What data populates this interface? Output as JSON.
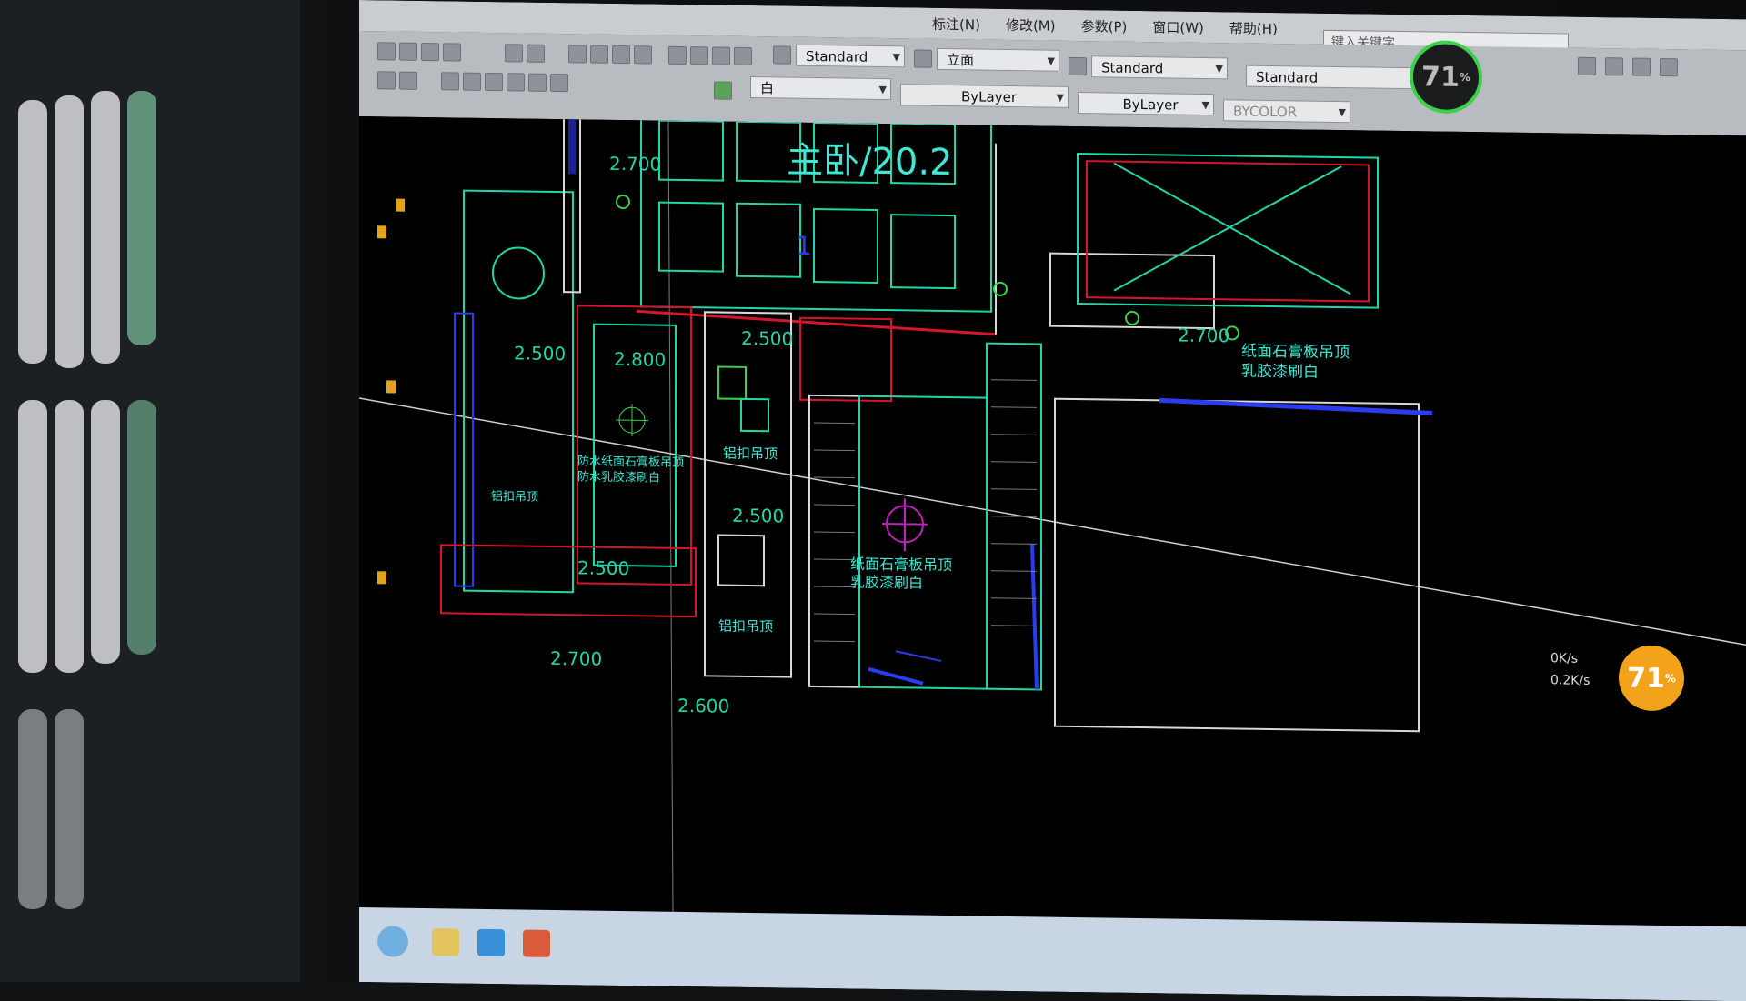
{
  "menu": {
    "items": [
      "标注(N)",
      "修改(M)",
      "参数(P)",
      "窗口(W)",
      "帮助(H)"
    ]
  },
  "search": {
    "placeholder": "键入关键字"
  },
  "toolbar": {
    "text_style": "Standard",
    "dim_style": "立面",
    "table_style": "Standard",
    "multileader_style": "Standard",
    "layer": "白",
    "linetype": "ByLayer",
    "lineweight": "ByLayer",
    "plotstyle": "BYCOLOR"
  },
  "drawing": {
    "room_label": "主卧/20.2",
    "room_number": "1",
    "heights": [
      "2.700",
      "2.500",
      "2.500",
      "2.800",
      "2.500",
      "2.500",
      "2.700",
      "2.600",
      "2.700"
    ],
    "notes": {
      "ceiling_gypsum_1": "纸面石膏板吊顶",
      "ceiling_gypsum_1b": "乳胶漆刷白",
      "ceiling_gypsum_2": "纸面石膏板吊顶",
      "ceiling_gypsum_2b": "乳胶漆刷白",
      "aluminum_1": "铝扣吊顶",
      "aluminum_2": "铝扣吊顶",
      "waterproof_1": "防水纸面石膏板吊顶",
      "waterproof_2": "防水乳胶漆刷白",
      "aluminum_left": "铝扣吊顶"
    }
  },
  "network_widget": {
    "percent": "71",
    "percent_unit": "%",
    "up": "0K/s",
    "down": "0.2K/s"
  },
  "colors": {
    "cad_bg": "#000000",
    "line_cyan": "#21d6a8",
    "line_red": "#d4152a",
    "line_white": "#d8d8d8",
    "line_blue": "#2a3cf0",
    "line_green": "#3bd14a",
    "text_cyan": "#3fe8d5",
    "widget_orange": "#f2a21b"
  }
}
